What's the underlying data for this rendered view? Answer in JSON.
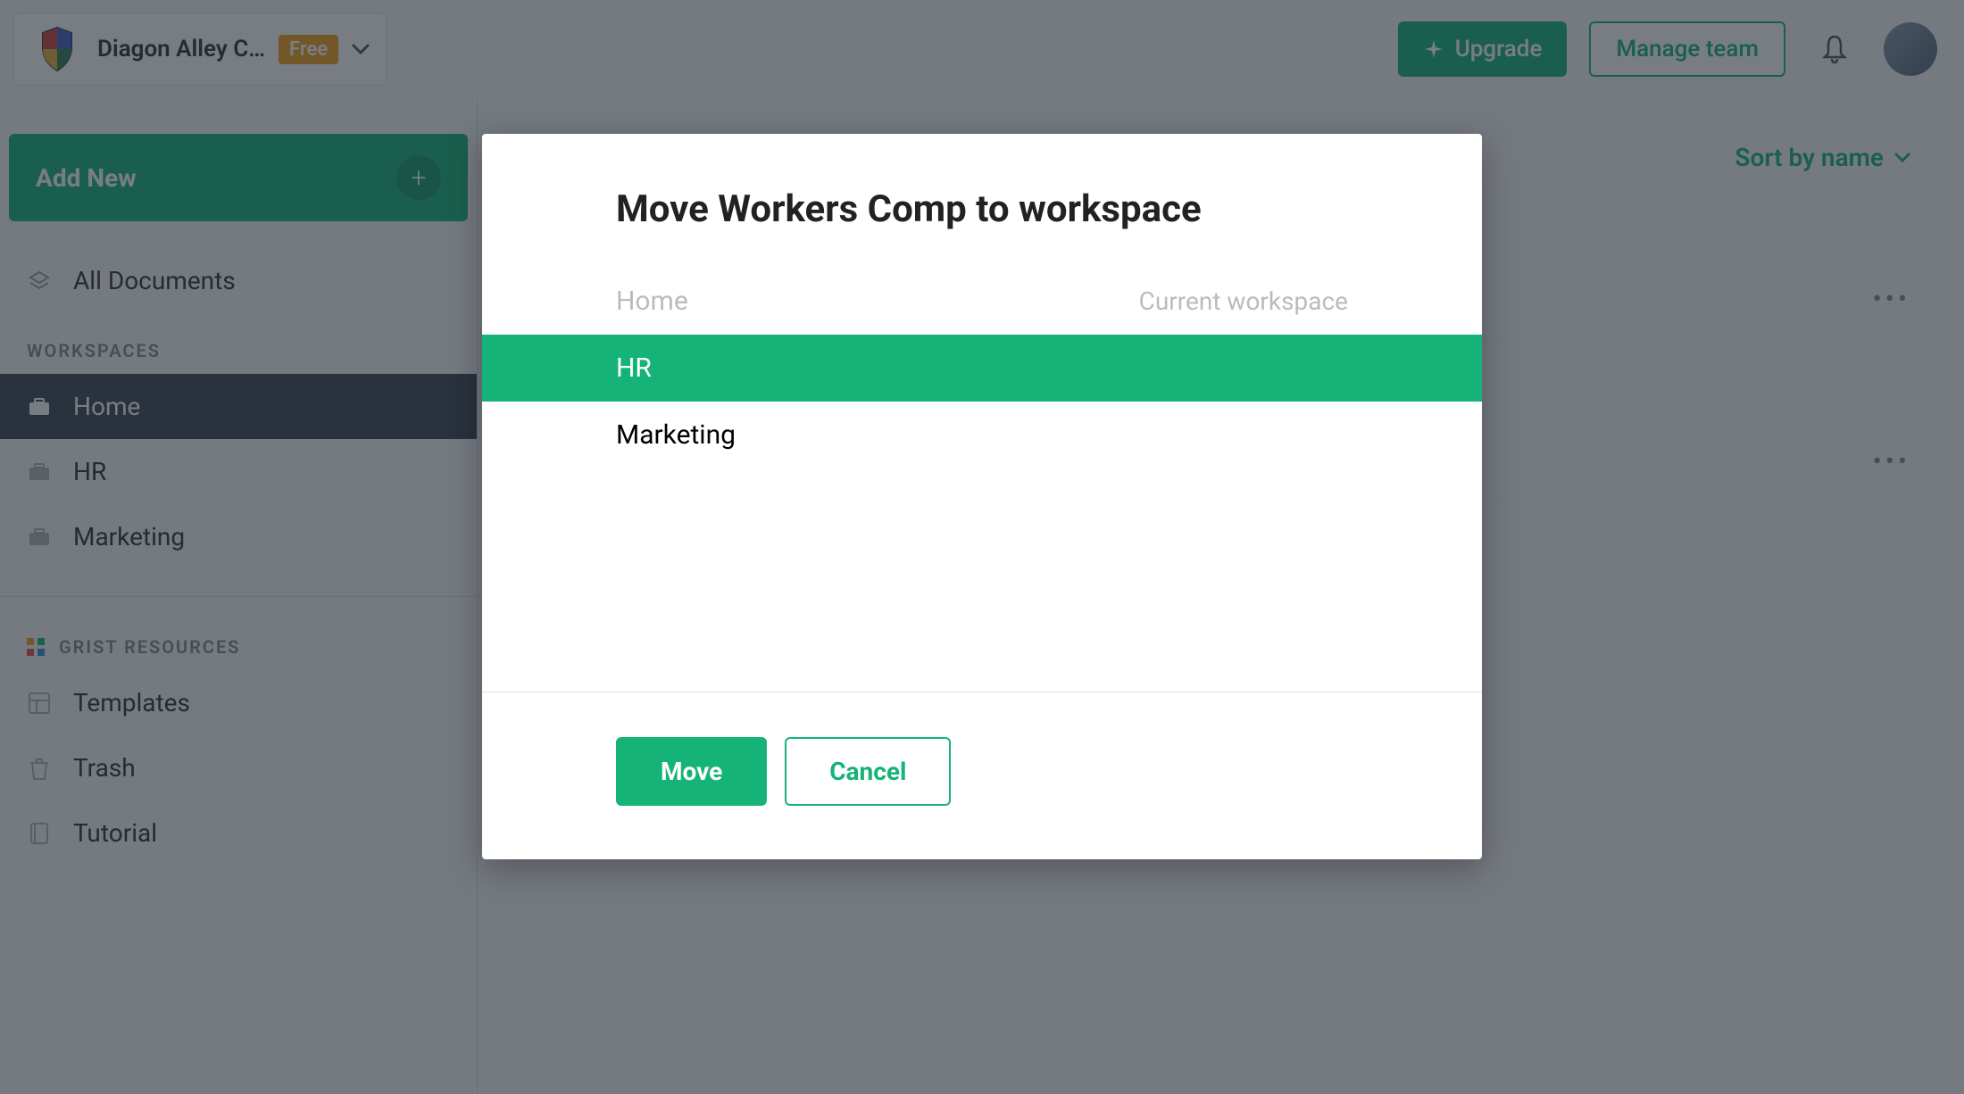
{
  "header": {
    "team_name": "Diagon Alley C…",
    "plan_badge": "Free",
    "upgrade_label": "Upgrade",
    "manage_team_label": "Manage team"
  },
  "sidebar": {
    "add_new_label": "Add New",
    "all_docs_label": "All Documents",
    "workspaces_label": "WORKSPACES",
    "workspaces": [
      {
        "label": "Home",
        "active": true
      },
      {
        "label": "HR",
        "active": false
      },
      {
        "label": "Marketing",
        "active": false
      }
    ],
    "resources_label": "GRIST RESOURCES",
    "resources": [
      {
        "label": "Templates"
      },
      {
        "label": "Trash"
      },
      {
        "label": "Tutorial"
      }
    ]
  },
  "main": {
    "sort_label": "Sort by name"
  },
  "modal": {
    "title": "Move Workers Comp to workspace",
    "current_note": "Current workspace",
    "workspaces": [
      {
        "label": "Home",
        "current": true,
        "selected": false
      },
      {
        "label": "HR",
        "current": false,
        "selected": true
      },
      {
        "label": "Marketing",
        "current": false,
        "selected": false
      }
    ],
    "move_label": "Move",
    "cancel_label": "Cancel"
  }
}
